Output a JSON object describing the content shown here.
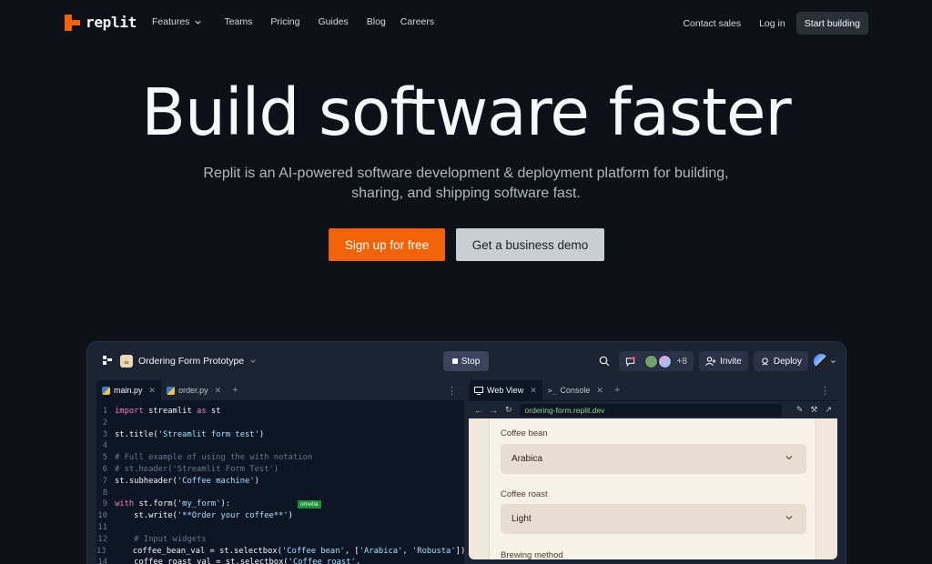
{
  "nav": {
    "logo_text": "replit",
    "links": [
      {
        "label": "Features",
        "has_dropdown": true
      },
      {
        "label": "Teams"
      },
      {
        "label": "Pricing"
      },
      {
        "label": "Guides"
      },
      {
        "label": "Blog"
      },
      {
        "label": "Careers"
      }
    ],
    "contact": "Contact sales",
    "login": "Log in",
    "start": "Start building"
  },
  "hero": {
    "title": "Build software faster",
    "subtitle": "Replit is an AI-powered software development & deployment platform for building, sharing, and shipping software fast.",
    "primary_cta": "Sign up for free",
    "secondary_cta": "Get a business demo"
  },
  "ide": {
    "repl_name": "Ordering Form Prototype",
    "stop": "Stop",
    "extra_users": "+8",
    "invite": "Invite",
    "deploy": "Deploy",
    "editor_tabs": [
      {
        "label": "main.py",
        "active": true
      },
      {
        "label": "order.py",
        "active": false
      }
    ],
    "right_tabs": [
      {
        "label": "Web View",
        "active": true
      },
      {
        "label": "Console",
        "active": false
      }
    ],
    "url": "ordering-form.replit.dev",
    "cursor_user": "ornella",
    "code_lines": [
      {
        "n": "1",
        "html": [
          [
            "kw",
            "import"
          ],
          [
            "tx",
            " streamlit "
          ],
          [
            "kw",
            "as"
          ],
          [
            "tx",
            " st"
          ]
        ]
      },
      {
        "n": "2",
        "html": []
      },
      {
        "n": "3",
        "html": [
          [
            "tx",
            "st.title("
          ],
          [
            "str",
            "'Streamlit form test'"
          ],
          [
            "tx",
            ")"
          ]
        ]
      },
      {
        "n": "4",
        "html": []
      },
      {
        "n": "5",
        "html": [
          [
            "cm",
            "# Full example of using the with notation"
          ]
        ]
      },
      {
        "n": "6",
        "html": [
          [
            "cm",
            "# st.header('Streamlit Form Test')"
          ]
        ]
      },
      {
        "n": "7",
        "html": [
          [
            "tx",
            "st.subheader("
          ],
          [
            "str",
            "'Coffee machine'"
          ],
          [
            "tx",
            ")"
          ]
        ]
      },
      {
        "n": "8",
        "html": []
      },
      {
        "n": "9",
        "html": [
          [
            "kw",
            "with"
          ],
          [
            "tx",
            " st.form("
          ],
          [
            "str",
            "'my_form'"
          ],
          [
            "tx",
            "):"
          ]
        ]
      },
      {
        "n": "10",
        "html": [
          [
            "tx",
            "    st.write("
          ],
          [
            "str",
            "'**Order your coffee**'"
          ],
          [
            "tx",
            ")"
          ]
        ]
      },
      {
        "n": "11",
        "html": []
      },
      {
        "n": "12",
        "html": [
          [
            "cm",
            "    # Input widgets"
          ]
        ]
      },
      {
        "n": "13",
        "html": [
          [
            "tx",
            "    coffee_bean_val = st.selectbox("
          ],
          [
            "str",
            "'Coffee bean'"
          ],
          [
            "tx",
            ", ["
          ],
          [
            "str",
            "'Arabica'"
          ],
          [
            "tx",
            ", "
          ],
          [
            "str",
            "'Robusta'"
          ],
          [
            "tx",
            "])"
          ]
        ]
      },
      {
        "n": "14",
        "html": [
          [
            "tx",
            "    coffee_roast_val = st.selectbox("
          ],
          [
            "str",
            "'Coffee roast'"
          ],
          [
            "tx",
            ","
          ]
        ]
      }
    ],
    "form": {
      "fields": [
        {
          "label": "Coffee bean",
          "value": "Arabica"
        },
        {
          "label": "Coffee roast",
          "value": "Light"
        },
        {
          "label": "Brewing method",
          "value": ""
        }
      ]
    }
  },
  "colors": {
    "accent": "#f26207",
    "background": "#0e1117",
    "ide_bg": "#1c2333"
  }
}
